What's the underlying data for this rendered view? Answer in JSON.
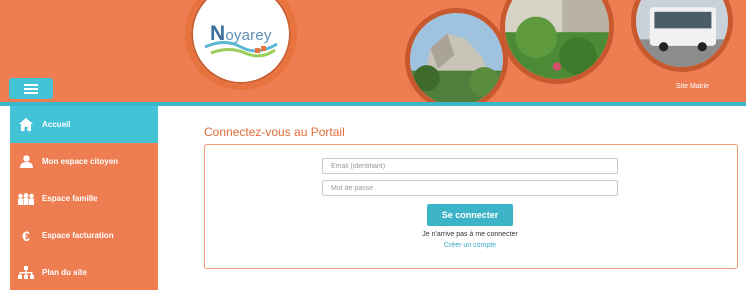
{
  "header": {
    "logo_text_initial": "N",
    "logo_text_rest": "oyarey",
    "site_link": "Site Mairie",
    "menu_icon": "hamburger-icon"
  },
  "sidebar": {
    "items": [
      {
        "label": "Accueil",
        "icon": "home-icon",
        "active": true
      },
      {
        "label": "Mon espace citoyen",
        "icon": "person-icon",
        "active": false
      },
      {
        "label": "Espace famille",
        "icon": "family-icon",
        "active": false
      },
      {
        "label": "Espace facturation",
        "icon": "euro-icon",
        "active": false
      },
      {
        "label": "Plan du site",
        "icon": "sitemap-icon",
        "active": false
      }
    ]
  },
  "login": {
    "title": "Connectez-vous au Portail",
    "email_placeholder": "Email (identifiant)",
    "password_placeholder": "Mot de passe",
    "submit_label": "Se connecter",
    "cant_connect": "Je n'arrive pas à me connecter",
    "create_account": "Créer un compte"
  },
  "colors": {
    "brand_orange": "#ee7e52",
    "accent_teal": "#44c3d6",
    "button_teal": "#3cb3c7"
  }
}
